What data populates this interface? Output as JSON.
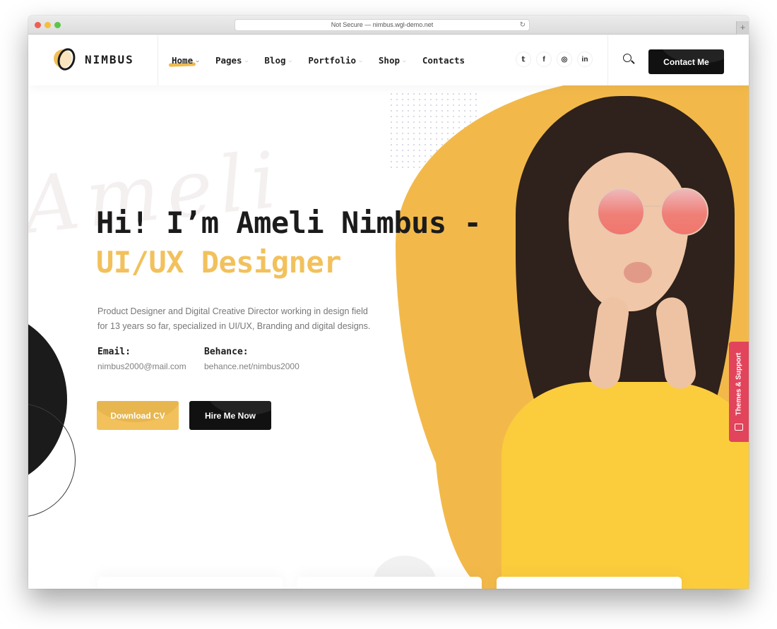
{
  "browser": {
    "url_text": "Not Secure — nimbus.wgl-demo.net",
    "reload_icon": "reload-icon",
    "new_tab_label": "+"
  },
  "header": {
    "logo_text": "NIMBUS",
    "nav": [
      {
        "label": "Home",
        "active": true,
        "has_dropdown": true
      },
      {
        "label": "Pages",
        "active": false,
        "has_dropdown": true
      },
      {
        "label": "Blog",
        "active": false,
        "has_dropdown": true
      },
      {
        "label": "Portfolio",
        "active": false,
        "has_dropdown": true
      },
      {
        "label": "Shop",
        "active": false,
        "has_dropdown": true
      },
      {
        "label": "Contacts",
        "active": false,
        "has_dropdown": false
      }
    ],
    "chevron": "⌵",
    "socials": [
      {
        "name": "twitter",
        "glyph": "𝕥"
      },
      {
        "name": "facebook",
        "glyph": "f"
      },
      {
        "name": "instagram",
        "glyph": "◎"
      },
      {
        "name": "linkedin",
        "glyph": "in"
      }
    ],
    "contact_button": "Contact Me"
  },
  "hero": {
    "watermark": "Ameli",
    "title_line1": "Hi! I’m Ameli Nimbus -",
    "title_line2": "UI/UX Designer",
    "description": "Product Designer and Digital Creative Director working in design field for 13 years so far, specialized in UI/UX, Branding and digital designs.",
    "email_label": "Email:",
    "email_value": "nimbus2000@mail.com",
    "behance_label": "Behance:",
    "behance_value": "behance.net/nimbus2000",
    "download_button": "Download CV",
    "hire_button": "Hire Me Now"
  },
  "support_tab": {
    "label": "Themes & Support"
  },
  "colors": {
    "accent_yellow": "#f2b94a",
    "dark": "#111111",
    "support_red": "#e2445c"
  }
}
